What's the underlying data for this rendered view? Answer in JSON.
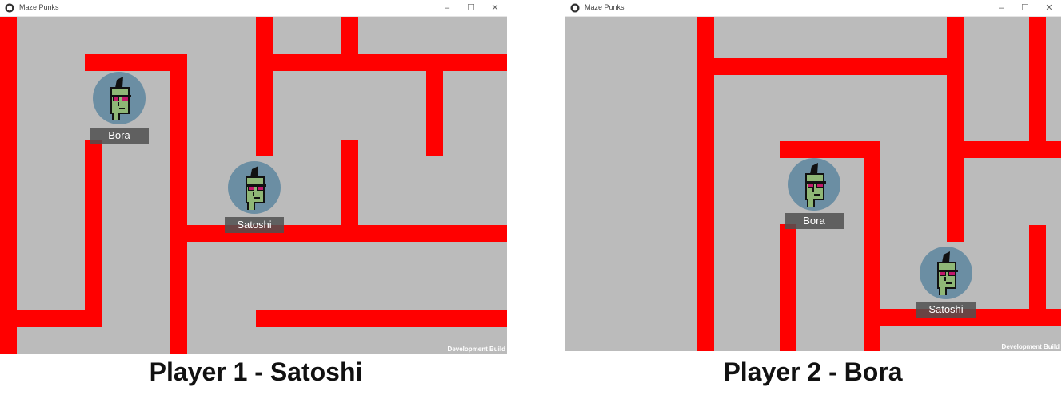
{
  "window_title": "Maze Punks",
  "dev_build_label": "Development Build",
  "wall_color": "#ff0000",
  "floor_color": "#bbbbbb",
  "avatar_bg_color": "#6b8ea3",
  "player1_view": {
    "caption": "Player 1 - Satoshi",
    "players": [
      {
        "name": "Bora"
      },
      {
        "name": "Satoshi"
      }
    ]
  },
  "player2_view": {
    "caption": "Player 2 - Bora",
    "players": [
      {
        "name": "Bora"
      },
      {
        "name": "Satoshi"
      }
    ]
  }
}
